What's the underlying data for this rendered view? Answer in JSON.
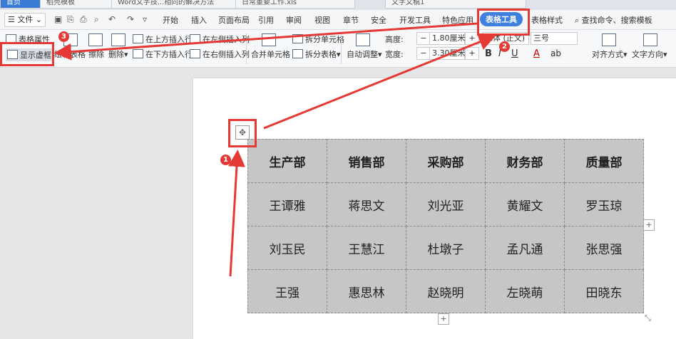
{
  "tabs": [
    "首页",
    "稻壳模板",
    "Word文字技...相同的解决方法",
    "日常重要工作.xls",
    "文字文稿1"
  ],
  "menu": {
    "file_label": "文件",
    "items": [
      "开始",
      "插入",
      "页面布局",
      "引用",
      "审阅",
      "视图",
      "章节",
      "安全",
      "开发工具",
      "特色应用",
      "表格工具",
      "表格样式"
    ],
    "search": "查找命令、搜索模板"
  },
  "ribbon": {
    "table_props": "表格属性",
    "show_gridlines": "显示虚框",
    "draw_table": "绘制表格",
    "erase": "擦除",
    "delete": "删除",
    "insert_above": "在上方插入行",
    "insert_below": "在下方插入行",
    "insert_left": "在左侧插入列",
    "insert_right": "在右侧插入列",
    "merge_cells": "合并单元格",
    "split_cells": "拆分单元格",
    "split_table": "拆分表格",
    "auto_fit": "自动调整",
    "height_label": "高度:",
    "height_value": "1.80厘米",
    "width_label": "宽度:",
    "width_value": "3.30厘米",
    "font_name": "宋体 (正文)",
    "font_size": "三号",
    "align": "对齐方式",
    "text_dir": "文字方向"
  },
  "table": {
    "header": [
      "生产部",
      "销售部",
      "采购部",
      "财务部",
      "质量部"
    ],
    "rows": [
      [
        "王谭雅",
        "蒋思文",
        "刘光亚",
        "黄耀文",
        "罗玉琼"
      ],
      [
        "刘玉民",
        "王慧江",
        "杜墩子",
        "孟凡通",
        "张思强"
      ],
      [
        "王强",
        "惠思林",
        "赵晓明",
        "左晓萌",
        "田晓东"
      ]
    ]
  },
  "badges": [
    "1",
    "2",
    "3"
  ],
  "colors": {
    "accent": "#3f7fe0",
    "annotation": "#e53935",
    "table_fill": "#c6c6c6"
  }
}
